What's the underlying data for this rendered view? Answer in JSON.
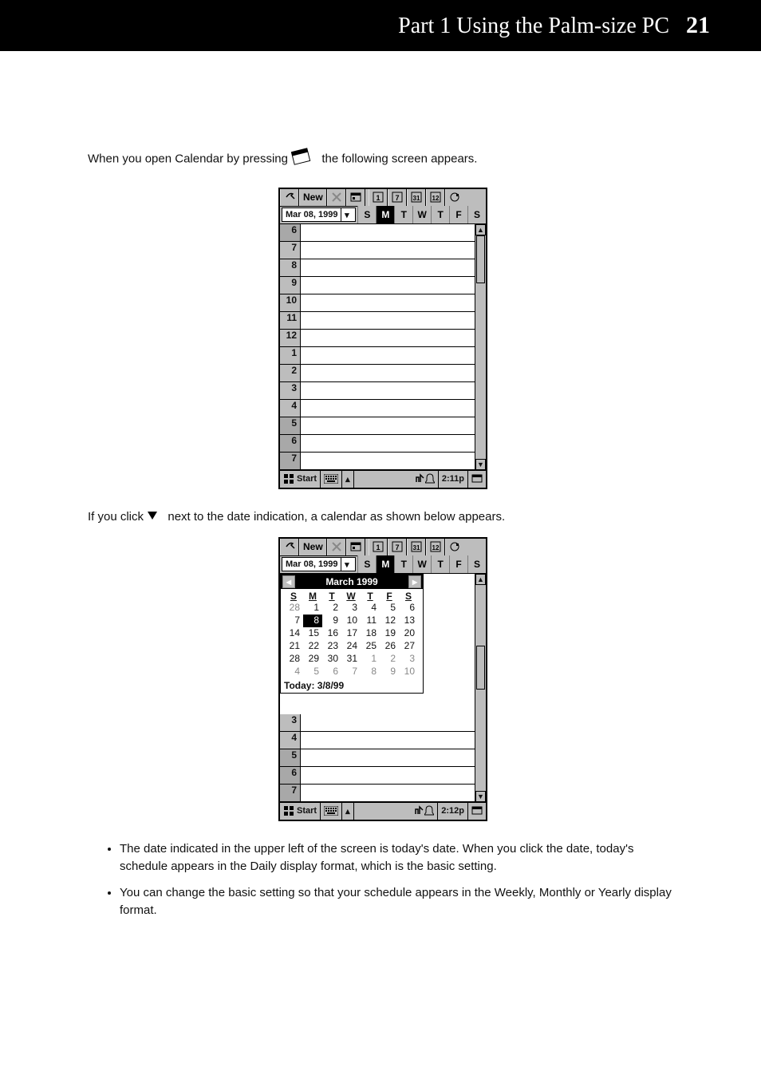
{
  "page_header": {
    "part_text": "Part 1  Using the Palm-size PC",
    "page_number": "21"
  },
  "intro": "When you open Calendar by pressing  the following screen appears.",
  "between": "If you click  next to the date indication, a calendar as shown below appears.",
  "bottom_notes": [
    "The date indicated in the upper left of the screen is today's date. When you click the date, today's schedule appears in the Daily display format, which is the basic setting.",
    "You can change the basic setting so that your schedule appears in the Weekly, Monthly or Yearly display format."
  ],
  "shot1": {
    "toolbar": {
      "new_label": "New",
      "view_btns": [
        "1",
        "7",
        "31",
        "12"
      ]
    },
    "date_text": "Mar 08, 1999",
    "dow": [
      "S",
      "M",
      "T",
      "W",
      "T",
      "F",
      "S"
    ],
    "dow_selected_index": 1,
    "hours": [
      "6",
      "7",
      "8",
      "9",
      "10",
      "11",
      "12",
      "1",
      "2",
      "3",
      "4",
      "5",
      "6",
      "7"
    ],
    "shaded_hours": [
      0,
      11,
      12,
      13
    ],
    "status": {
      "start": "Start",
      "time": "2:11p"
    }
  },
  "shot2": {
    "toolbar": {
      "new_label": "New",
      "view_btns": [
        "1",
        "7",
        "31",
        "12"
      ]
    },
    "date_text": "Mar 08, 1999",
    "dow": [
      "S",
      "M",
      "T",
      "W",
      "T",
      "F",
      "S"
    ],
    "dow_selected_index": 1,
    "month_header": "March 1999",
    "month_dow": [
      "S",
      "M",
      "T",
      "W",
      "T",
      "F",
      "S"
    ],
    "month_rows": [
      [
        {
          "v": "28",
          "off": true
        },
        {
          "v": "1"
        },
        {
          "v": "2"
        },
        {
          "v": "3"
        },
        {
          "v": "4"
        },
        {
          "v": "5"
        },
        {
          "v": "6"
        }
      ],
      [
        {
          "v": "7"
        },
        {
          "v": "8",
          "sel": true
        },
        {
          "v": "9"
        },
        {
          "v": "10"
        },
        {
          "v": "11"
        },
        {
          "v": "12"
        },
        {
          "v": "13"
        }
      ],
      [
        {
          "v": "14"
        },
        {
          "v": "15"
        },
        {
          "v": "16"
        },
        {
          "v": "17"
        },
        {
          "v": "18"
        },
        {
          "v": "19"
        },
        {
          "v": "20"
        }
      ],
      [
        {
          "v": "21"
        },
        {
          "v": "22"
        },
        {
          "v": "23"
        },
        {
          "v": "24"
        },
        {
          "v": "25"
        },
        {
          "v": "26"
        },
        {
          "v": "27"
        }
      ],
      [
        {
          "v": "28"
        },
        {
          "v": "29"
        },
        {
          "v": "30"
        },
        {
          "v": "31"
        },
        {
          "v": "1",
          "off": true
        },
        {
          "v": "2",
          "off": true
        },
        {
          "v": "3",
          "off": true
        }
      ],
      [
        {
          "v": "4",
          "off": true
        },
        {
          "v": "5",
          "off": true
        },
        {
          "v": "6",
          "off": true
        },
        {
          "v": "7",
          "off": true
        },
        {
          "v": "8",
          "off": true
        },
        {
          "v": "9",
          "off": true
        },
        {
          "v": "10",
          "off": true
        }
      ]
    ],
    "today_text": "Today: 3/8/99",
    "hours": [
      "3",
      "4",
      "5",
      "6",
      "7"
    ],
    "shaded_hours": [
      2,
      3,
      4
    ],
    "status": {
      "start": "Start",
      "time": "2:12p"
    }
  }
}
